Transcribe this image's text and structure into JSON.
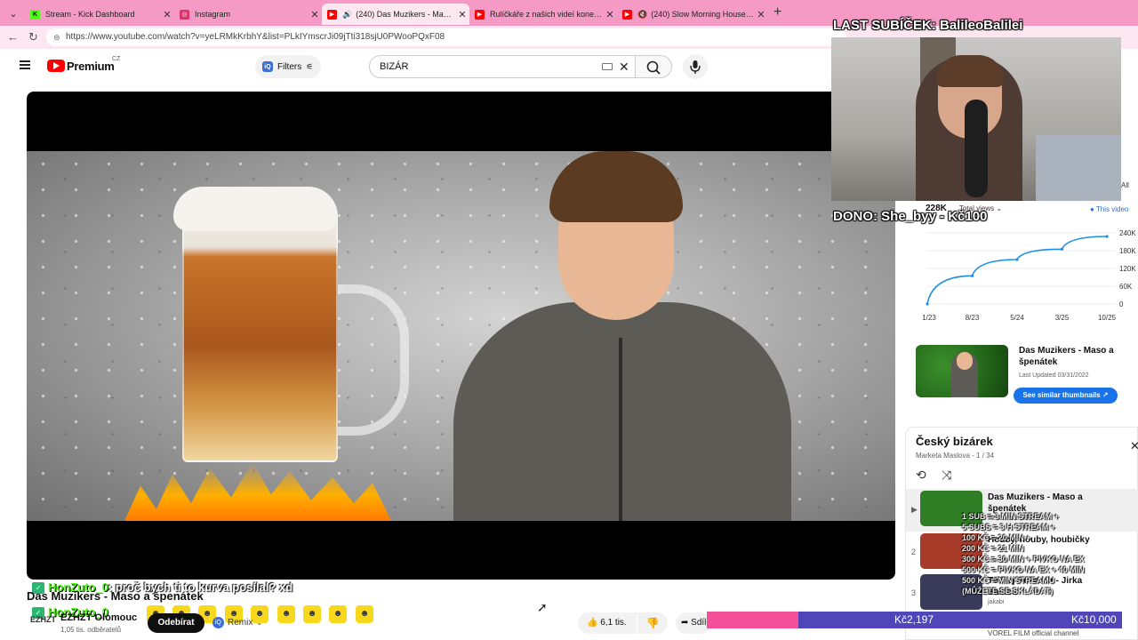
{
  "browser": {
    "tabs": [
      {
        "title": "Stream - Kick Dashboard",
        "icon": "kick-icon",
        "color": "#53fc18"
      },
      {
        "title": "Instagram",
        "icon": "instagram-icon",
        "color": "#e1306c"
      },
      {
        "title": "(240) Das Muzikers - Maso a š",
        "icon": "youtube-icon",
        "color": "#ff0000"
      },
      {
        "title": "Rulíčkáře z našich videí konečně ď",
        "icon": "youtube-icon",
        "color": "#ff0000"
      },
      {
        "title": "(240) Slow Morning House M",
        "icon": "youtube-icon",
        "color": "#ff0000"
      }
    ],
    "url": "https://www.youtube.com/watch?v=yeLRMkKrbhY&list=PLkIYmscrJi09jTti318sjU0PWooPQxF08"
  },
  "header": {
    "brand": "Premium",
    "region": "CZ",
    "filters_label": "Filters",
    "search_value": "BIZÁR"
  },
  "video": {
    "title": "Das Muzikers - Maso a špenátek",
    "channel": "EZHZT Olomouc",
    "channel_logo": "EZHZT",
    "subscribers": "1,05 tis. odběratelů",
    "subscribe_label": "Odebírat",
    "remix_label": "Remix",
    "likes": "6,1 tis.",
    "share_label": "Sdílet"
  },
  "chat": [
    {
      "user": "HonZuto_0",
      "message": ": proč bych ti to kurva posílal? xd"
    },
    {
      "user": "HonZuto_0",
      "message": ""
    }
  ],
  "stream_overlay": {
    "last_sub": "LAST SUBÍČEK: BalileoBalilei",
    "dono": "DONO: She_byy - Kč100",
    "info_lines": [
      "1 SUB = 3 MIN STREAM +",
      "5 SUBS = 3 H STREAM +",
      "100 KČ = 20 MIN +",
      "200 KČ = 21 MIN",
      "300 KČ = 30 MIN + PIVKO NA EX",
      "500 KČ = PIVKO NA EX + 40 MIN",
      "500 KČ = MIN STREAMU",
      "(MŮŽETE SE SKLÁDAT)"
    ],
    "goal_current": "Kč2,197",
    "goal_target": "Kč10,000",
    "goal_fraction": 0.2197
  },
  "stats": {
    "views": "228K",
    "views_label": "Total views",
    "this_video": "This video",
    "all_label": "All",
    "chart_data": {
      "type": "line",
      "x": [
        "1/23",
        "8/23",
        "5/24",
        "3/25",
        "10/25"
      ],
      "yticks": [
        "0",
        "60K",
        "120K",
        "180K",
        "240K"
      ],
      "values": [
        0,
        95000,
        150000,
        185000,
        228000
      ],
      "ylim": [
        0,
        240000
      ]
    },
    "card_title": "Das Muzikers - Maso a špenátek",
    "card_updated": "Last Updated 03/31/2022",
    "similar_label": "See similar thumbnails"
  },
  "playlist": {
    "title": "Český bizárek",
    "owner": "Marketa Maslova - 1 / 34",
    "items": [
      {
        "num": "▶",
        "title": "Das Muzikers - Maso a špenátek",
        "channel": "EZHZT Olomouc",
        "thumb": "#2f7d24"
      },
      {
        "num": "2",
        "title": "Houby, houby, houbičky",
        "channel": "horicen",
        "thumb": "#a73b2a"
      },
      {
        "num": "3",
        "title": "Těžkej Pokondr - Jirka Babica",
        "channel": "jakabi",
        "thumb": "#3a3a5a"
      }
    ],
    "last_channel": "VOREL FILM official channel"
  }
}
